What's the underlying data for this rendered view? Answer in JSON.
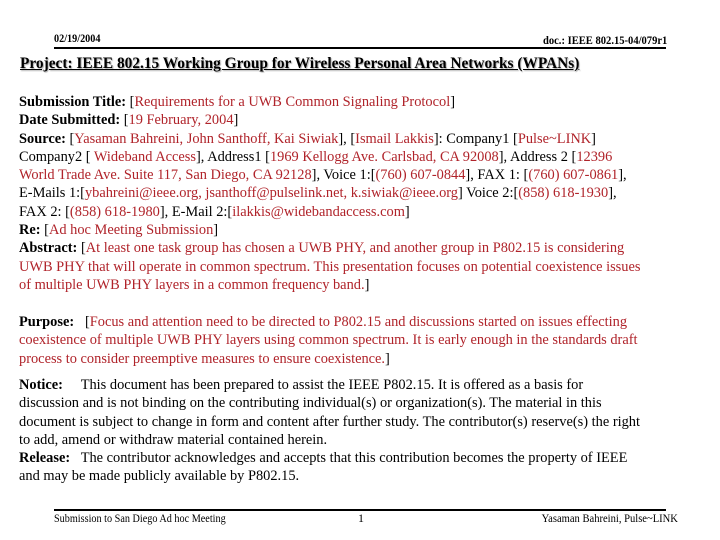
{
  "header": {
    "date": "02/19/2004",
    "doc_id": "doc.: IEEE 802.15-04/079r1",
    "project": "Project: IEEE 802.15 Working Group for Wireless Personal Area Networks (WPANs)"
  },
  "fields": {
    "submission_title": {
      "label": "Submission Title:",
      "value": "Requirements for a UWB Common Signaling Protocol"
    },
    "date_submitted": {
      "label": "Date Submitted:",
      "value": "19 February, 2004"
    },
    "source": {
      "label": "Source:",
      "authors1": "Yasaman Bahreini, John Santhoff, Kai Siwiak",
      "authors2": "Ismail Lakkis",
      "company1_label": "Company1",
      "company1": "Pulse~LINK",
      "company2_label": "Company2",
      "company2": " Wideband Access",
      "address1_label": "Address1",
      "address1": "1969 Kellogg Ave. Carlsbad, CA 92008",
      "address2_label": "Address 2",
      "address2_part1": "12396",
      "address2_part2": "World Trade Ave. Suite 117, San Diego, CA 92128",
      "voice1_label": "Voice 1:",
      "voice1": "(760) 607-0844",
      "fax1_label": "FAX 1:",
      "fax1": "(760) 607-0861",
      "emails1_label": "E-Mails 1:",
      "emails1": "ybahreini@ieee.org, jsanthoff@pulselink.net, k.siwiak@ieee.org",
      "voice2_label": "Voice 2:",
      "voice2": "(858) 618-1930",
      "fax2_label": "FAX 2:",
      "fax2": "(858) 618-1980",
      "email2_label": "E-Mail 2:",
      "email2": "ilakkis@widebandaccess.com"
    },
    "re": {
      "label": "Re:",
      "value": "Ad hoc Meeting Submission"
    },
    "abstract": {
      "label": "Abstract:",
      "lines": [
        "At least one task group has chosen a UWB PHY, and another group in P802.15 is considering",
        "UWB PHY that will operate in common spectrum. This presentation focuses on potential coexistence issues",
        "of multiple UWB PHY layers in a common frequency band."
      ]
    },
    "purpose": {
      "label": "Purpose:",
      "lines": [
        "Focus and attention need to be directed to P802.15 and discussions started on issues effecting",
        "coexistence of multiple UWB PHY layers using common spectrum. It is early enough in the standards draft",
        "process to consider preemptive measures to ensure coexistence."
      ]
    },
    "notice": {
      "label": "Notice:",
      "lines": [
        "This document has been prepared to assist the IEEE P802.15.  It is offered as a basis for",
        "discussion and is not binding on the contributing individual(s) or organization(s). The material in this",
        "document is subject to change in form and content after further study. The contributor(s) reserve(s) the right",
        "to add, amend or withdraw material contained herein."
      ]
    },
    "release": {
      "label": "Release:",
      "lines": [
        "The contributor acknowledges and accepts that this contribution becomes the property of IEEE",
        "and may be made publicly available by P802.15."
      ]
    }
  },
  "footer": {
    "left": "Submission to San Diego Ad hoc Meeting",
    "page": "1",
    "right": "Yasaman Bahreini, Pulse~LINK"
  },
  "colors": {
    "field_value": "#b0232a",
    "text": "#000000"
  }
}
